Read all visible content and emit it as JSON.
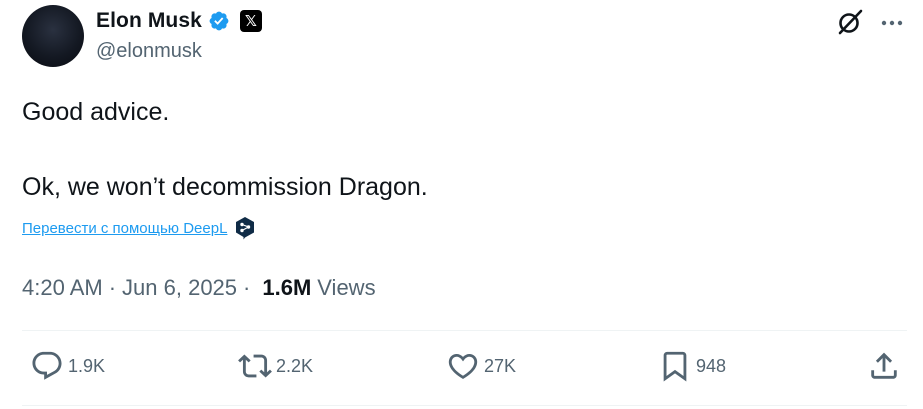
{
  "author": {
    "name": "Elon Musk",
    "handle": "@elonmusk",
    "affiliate_badge": "𝕏"
  },
  "tweet": {
    "lines": [
      "Good advice.",
      "Ok, we won’t decommission Dragon."
    ],
    "translate_link": "Перевести с помощью DeepL",
    "time": "4:20 AM",
    "date": "Jun 6, 2025",
    "separator": "·",
    "views_count": "1.6M",
    "views_label": "Views"
  },
  "actions": {
    "replies": "1.9K",
    "reposts": "2.2K",
    "likes": "27K",
    "bookmarks": "948"
  },
  "icons": {
    "verified": "verified-badge-icon",
    "affiliate": "x-logo-icon",
    "grok": "grok-icon",
    "more": "more-dots-icon",
    "deepl": "deepl-icon",
    "reply": "reply-icon",
    "repost": "repost-icon",
    "like": "heart-icon",
    "bookmark": "bookmark-icon",
    "share": "share-icon"
  },
  "colors": {
    "text": "#0f1419",
    "secondary": "#536471",
    "link": "#1d9bf0",
    "verified": "#1d9bf0",
    "deepl": "#0f2b46"
  }
}
